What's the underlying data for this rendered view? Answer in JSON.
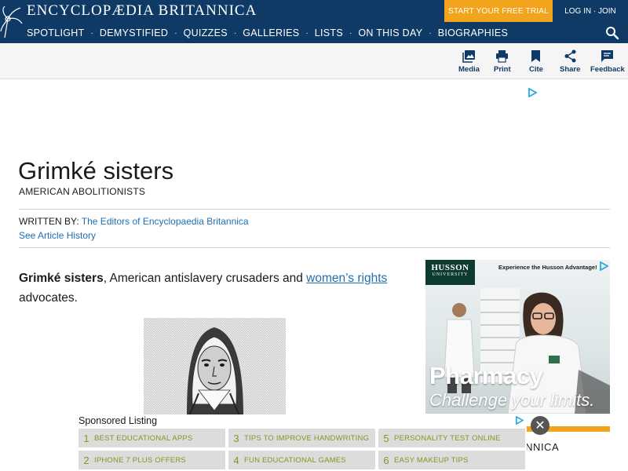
{
  "header": {
    "logo": "ENCYCLOPÆDIA BRITANNICA",
    "trial_cta": "START YOUR FREE TRIAL",
    "login": "LOG IN · JOIN",
    "nav": [
      "SPOTLIGHT",
      "DEMYSTIFIED",
      "QUIZZES",
      "GALLERIES",
      "LISTS",
      "ON THIS DAY",
      "BIOGRAPHIES"
    ],
    "nav_separator": "·"
  },
  "toolbar": {
    "media": "Media",
    "print": "Print",
    "cite": "Cite",
    "share": "Share",
    "feedback": "Feedback"
  },
  "article": {
    "title": "Grimké sisters",
    "subtitle": "AMERICAN ABOLITIONISTS",
    "written_by_label": "WRITTEN BY:",
    "author": "The Editors of Encyclopaedia Britannica",
    "history_link": "See Article History",
    "intro_bold": "Grimké sisters",
    "intro_text1": ", American antislavery crusaders and ",
    "intro_link": "women’s rights",
    "intro_text2": " advocates."
  },
  "side_ad": {
    "brand_line1": "HUSSON",
    "brand_line2": "UNIVERSITY",
    "tagline": "Experience the Husson Advantage!",
    "headline": "Pharmacy",
    "subline": "Challenge your limits.",
    "close": "✕",
    "behind_text": "ANNICA"
  },
  "sponsored": {
    "title": "Sponsored Listing",
    "items": [
      {
        "num": "1",
        "label": "BEST EDUCATIONAL APPS"
      },
      {
        "num": "3",
        "label": "TIPS TO IMPROVE HANDWRITING"
      },
      {
        "num": "5",
        "label": "PERSONALITY TEST ONLINE"
      },
      {
        "num": "2",
        "label": "IPHONE 7 PLUS OFFERS"
      },
      {
        "num": "4",
        "label": "FUN EDUCATIONAL GAMES"
      },
      {
        "num": "6",
        "label": "EASY MAKEUP TIPS"
      }
    ]
  },
  "colors": {
    "header_bg": "#0f3a66",
    "cta_orange": "#f2a41c",
    "link_blue": "#1e6fb3",
    "sponsored_green": "#7a9b20"
  }
}
